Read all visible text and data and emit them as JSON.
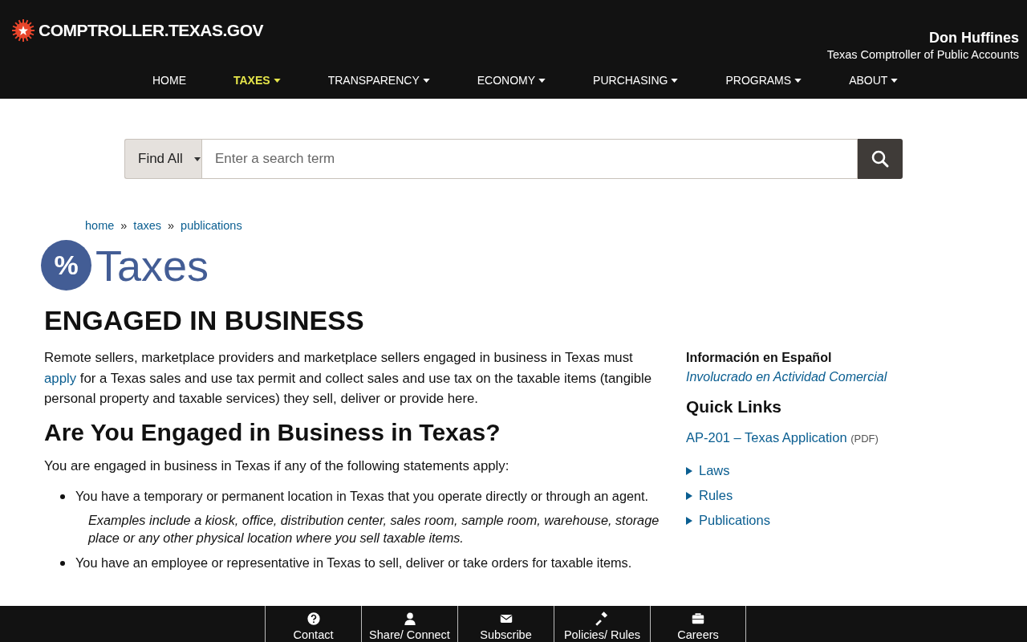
{
  "header": {
    "logo": "COMPTROLLER.TEXAS.GOV",
    "official_name": "Don Huffines",
    "official_title": "Texas Comptroller of Public Accounts"
  },
  "nav": [
    {
      "label": "HOME",
      "has_menu": false,
      "selected": false
    },
    {
      "label": "TAXES",
      "has_menu": true,
      "selected": true
    },
    {
      "label": "TRANSPARENCY",
      "has_menu": true,
      "selected": false
    },
    {
      "label": "ECONOMY",
      "has_menu": true,
      "selected": false
    },
    {
      "label": "PURCHASING",
      "has_menu": true,
      "selected": false
    },
    {
      "label": "PROGRAMS",
      "has_menu": true,
      "selected": false
    },
    {
      "label": "ABOUT",
      "has_menu": true,
      "selected": false
    }
  ],
  "search": {
    "scope": "Find All",
    "placeholder": "Enter a search term"
  },
  "breadcrumbs": {
    "separator": "»",
    "items": [
      "home",
      "taxes",
      "publications"
    ]
  },
  "section": {
    "icon_text": "%",
    "title": "Taxes"
  },
  "main": {
    "heading": "ENGAGED IN BUSINESS",
    "intro": {
      "before": "Remote sellers, marketplace providers and marketplace sellers engaged in business in Texas must",
      "link": "apply",
      "after": "for a Texas sales and use tax permit and collect sales and use tax on the taxable items (tangible personal property and taxable services) they sell, deliver or provide here."
    },
    "subheading": "Are You Engaged in Business in Texas?",
    "lead": "You are engaged in business in Texas if any of the following statements apply:",
    "bullets": [
      {
        "text": "You have a temporary or permanent location in Texas that you operate directly or through an agent.",
        "example": "Examples include a kiosk, office, distribution center, sales room, sample room, warehouse, storage place or any other physical location where you sell taxable items."
      },
      {
        "text": "You have an employee or representative in Texas to sell, deliver or take orders for taxable items."
      }
    ]
  },
  "sidebar": {
    "spanish_heading": "Información en Español",
    "spanish_link": "Involucrado en Actividad Comercial",
    "quick_links_heading": "Quick Links",
    "document": {
      "label": "AP-201 – Texas Application",
      "format": "(PDF)"
    },
    "expanders": [
      {
        "label": "Laws",
        "expanded": false
      },
      {
        "label": "Rules",
        "expanded": false
      },
      {
        "label": "Publications",
        "expanded": false
      }
    ]
  },
  "footer": [
    {
      "kind": "question",
      "label": "Contact"
    },
    {
      "kind": "person",
      "label": "Share/ Connect"
    },
    {
      "kind": "envelope",
      "label": "Subscribe"
    },
    {
      "kind": "gavel",
      "label": "Policies/ Rules"
    },
    {
      "kind": "briefcase",
      "label": "Careers"
    }
  ]
}
